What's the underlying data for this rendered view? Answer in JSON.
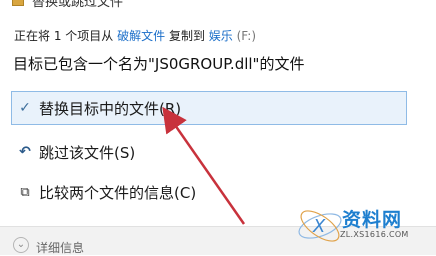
{
  "window": {
    "title": "替换或跳过文件",
    "icon": "folder-copy-icon"
  },
  "info": {
    "prefix": "正在将 1 个项目从",
    "source": "破解文件",
    "middle": "复制到",
    "destination": "娱乐",
    "drive": "(F:)"
  },
  "heading": "目标已包含一个名为\"JS0GROUP.dll\"的文件",
  "options": [
    {
      "icon": "checkmark-icon",
      "glyph": "✓",
      "label": "替换目标中的文件(R)",
      "selected": true
    },
    {
      "icon": "skip-arrow-icon",
      "glyph": "↶",
      "label": "跳过该文件(S)"
    },
    {
      "icon": "compare-documents-icon",
      "glyph": "⧉",
      "label": "比较两个文件的信息(C)"
    }
  ],
  "footer": {
    "details_label": "详细信息",
    "icon": "chevron-down-icon"
  },
  "annotation": {
    "arrow_color": "#c8323c"
  },
  "watermark": {
    "text": "资料网",
    "subtext": "ZL.XS1616.COM"
  },
  "colors": {
    "link": "#1c6fc9",
    "selected_bg": "#e9f2fb",
    "selected_border": "#8fbbe6",
    "footer_bg": "#f2f2f2"
  }
}
